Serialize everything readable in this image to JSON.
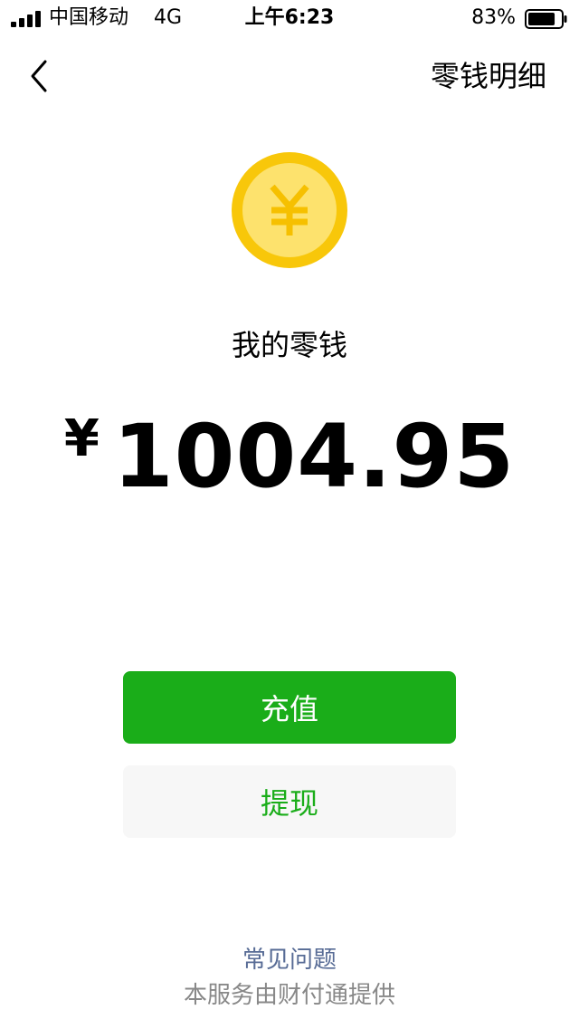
{
  "status_bar": {
    "carrier": "中国移动",
    "network": "4G",
    "time": "上午6:23",
    "battery": "83%",
    "battery_level": 0.83
  },
  "nav": {
    "back_icon": "chevron-left-icon",
    "right_link": "零钱明细"
  },
  "wallet": {
    "coin_icon": "yuan-coin-icon",
    "label": "我的零钱",
    "currency_symbol": "¥",
    "amount": "1004.95"
  },
  "actions": {
    "recharge": "充值",
    "withdraw": "提现"
  },
  "footer": {
    "faq": "常见问题",
    "provider": "本服务由财付通提供"
  },
  "colors": {
    "primary_green": "#1aad19",
    "link_blue": "#576b95",
    "coin_outer": "#f8c70a",
    "coin_inner": "#fde26d"
  }
}
